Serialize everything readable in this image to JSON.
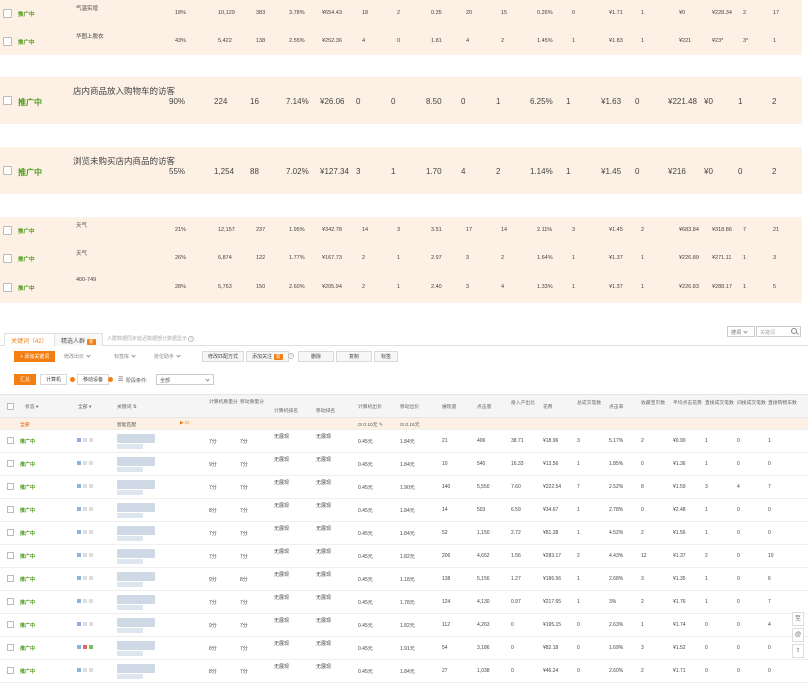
{
  "top_rows": [
    {
      "status": "推广中",
      "name": "气温实增",
      "pct": "18%",
      "views": "10,129",
      "clicks": "383",
      "ctr": "3.78%",
      "cost": "¥654.43",
      "c1": "18",
      "c2": "2",
      "c3": "0.35",
      "c4": "20",
      "c5": "15",
      "rate": "0.26%",
      "c6": "0",
      "cpc": "¥1.71",
      "c7": "1",
      "c8": "¥0",
      "c9": "¥228.34",
      "c10": "2",
      "c11": "17"
    },
    {
      "status": "推广中",
      "name": "华图上脱衣",
      "pct": "43%",
      "views": "5,422",
      "clicks": "138",
      "ctr": "2.55%",
      "cost": "¥252.36",
      "c1": "4",
      "c2": "0",
      "c3": "1.81",
      "c4": "4",
      "c5": "2",
      "rate": "1.45%",
      "c6": "1",
      "cpc": "¥1.83",
      "c7": "1",
      "c8": "¥221",
      "c9": "¥23*",
      "c10": "3*",
      "c11": "1"
    },
    {
      "status": "推广中",
      "name": "店内商品放入购物车的访客",
      "pct": "90%",
      "views": "224",
      "clicks": "16",
      "ctr": "7.14%",
      "cost": "¥26.06",
      "c1": "0",
      "c2": "0",
      "c3": "8.50",
      "c4": "0",
      "c5": "1",
      "rate": "6.25%",
      "c6": "1",
      "cpc": "¥1.63",
      "c7": "0",
      "c8": "¥221.48",
      "c9": "¥0",
      "c10": "1",
      "c11": "2"
    },
    {
      "status": "推广中",
      "name": "浏览未购买店内商品的访客",
      "pct": "55%",
      "views": "1,254",
      "clicks": "88",
      "ctr": "7.02%",
      "cost": "¥127.34",
      "c1": "3",
      "c2": "1",
      "c3": "1.70",
      "c4": "4",
      "c5": "2",
      "rate": "1.14%",
      "c6": "1",
      "cpc": "¥1.45",
      "c7": "0",
      "c8": "¥216",
      "c9": "¥0",
      "c10": "0",
      "c11": "2"
    },
    {
      "status": "推广中",
      "name": "天气",
      "pct": "21%",
      "views": "12,157",
      "clicks": "237",
      "ctr": "1.95%",
      "cost": "¥342.78",
      "c1": "14",
      "c2": "3",
      "c3": "3.51",
      "c4": "17",
      "c5": "14",
      "rate": "2.11%",
      "c6": "3",
      "cpc": "¥1.45",
      "c7": "2",
      "c8": "¥683.84",
      "c9": "¥318.86",
      "c10": "7",
      "c11": "21"
    },
    {
      "status": "推广中",
      "name": "天气",
      "pct": "26%",
      "views": "6,874",
      "clicks": "122",
      "ctr": "1.77%",
      "cost": "¥167.73",
      "c1": "2",
      "c2": "1",
      "c3": "2.97",
      "c4": "3",
      "c5": "2",
      "rate": "1.64%",
      "c6": "1",
      "cpc": "¥1.37",
      "c7": "1",
      "c8": "¥226.89",
      "c9": "¥271.11",
      "c10": "1",
      "c11": "3"
    },
    {
      "status": "推广中",
      "name": "400-749",
      "pct": "28%",
      "views": "5,763",
      "clicks": "150",
      "ctr": "2.60%",
      "cost": "¥205.94",
      "c1": "2",
      "c2": "1",
      "c3": "2.40",
      "c4": "3",
      "c5": "4",
      "rate": "1.33%",
      "c6": "1",
      "cpc": "¥1.37",
      "c7": "1",
      "c8": "¥226.83",
      "c9": "¥288.17",
      "c10": "1",
      "c11": "5"
    }
  ],
  "tabs": {
    "keywords": "关键词（42）",
    "crowd": "精选人群",
    "crowd_badge": "新",
    "hint": "人群数据同步延迟数据部分数据显示"
  },
  "search": {
    "select": "搜词",
    "placeholder": "关键词"
  },
  "toolbar": {
    "add": "+ 添加关键词",
    "modify_bid": "修改出价",
    "label": "标签库",
    "position": "抢位助手",
    "match": "修改匹配方式",
    "attention": "添加关注",
    "attention_badge": "新",
    "delete": "删除",
    "copy": "复制",
    "tag": "标签"
  },
  "filter": {
    "summary": "汇总",
    "computer": "计算机",
    "mobile": "移动设备",
    "period_label": "阶段条件:",
    "period_value": "全部"
  },
  "table": {
    "headers": {
      "status": "状态",
      "all": "全部",
      "keyword": "关键词",
      "pc_quality": "计算机质量分",
      "mobile_quality": "移动质量分",
      "pc_rank": "计算机排名",
      "mobile_rank": "移动排名",
      "pc_bid": "计算机出价",
      "mobile_bid": "移动出价",
      "impressions": "展现量",
      "clicks": "点击量",
      "roi": "投入产出比",
      "cost": "花费",
      "orders": "总成交笔数",
      "ctr": "点击率",
      "fav_items": "收藏宝贝数",
      "avg_cpc": "平均点击花费",
      "direct_orders": "直接成交笔数",
      "indirect_orders": "间接成交笔数",
      "direct_fav": "直接购物车数"
    },
    "subheader": {
      "status": "全部",
      "keyword": "智能匹配",
      "pc_bid": "0.10元",
      "mobile_bid": "0.16元"
    },
    "rows": [
      {
        "status": "推广中",
        "pcq": "7分",
        "mq": "7分",
        "pcr": "无展现",
        "mr": "无展现",
        "pcb": "0.45元",
        "mb": "1.84元",
        "imp": "21",
        "clk": "406",
        "roi": "38.71",
        "cost": "¥18.96",
        "ord": "3",
        "ctr": "5.17%",
        "fav": "2",
        "cpc": "¥0.90",
        "d": "1",
        "i": "0",
        "f": "1"
      },
      {
        "status": "推广中",
        "pcq": "9分",
        "mq": "7分",
        "pcr": "无展现",
        "mr": "无展现",
        "pcb": "0.45元",
        "mb": "1.84元",
        "imp": "10",
        "clk": "540",
        "roi": "16.33",
        "cost": "¥13.56",
        "ord": "1",
        "ctr": "1.85%",
        "fav": "0",
        "cpc": "¥1.36",
        "d": "1",
        "i": "0",
        "f": "0"
      },
      {
        "status": "推广中",
        "pcq": "7分",
        "mq": "7分",
        "pcr": "无展现",
        "mr": "无展现",
        "pcb": "0.45元",
        "mb": "1.90元",
        "imp": "140",
        "clk": "5,550",
        "roi": "7.60",
        "cost": "¥222.54",
        "ord": "7",
        "ctr": "2.52%",
        "fav": "8",
        "cpc": "¥1.59",
        "d": "3",
        "i": "4",
        "f": "7"
      },
      {
        "status": "推广中",
        "pcq": "8分",
        "mq": "7分",
        "pcr": "无展现",
        "mr": "无展现",
        "pcb": "0.45元",
        "mb": "1.84元",
        "imp": "14",
        "clk": "503",
        "roi": "6.59",
        "cost": "¥34.67",
        "ord": "1",
        "ctr": "2.78%",
        "fav": "0",
        "cpc": "¥2.48",
        "d": "1",
        "i": "0",
        "f": "0"
      },
      {
        "status": "推广中",
        "pcq": "7分",
        "mq": "7分",
        "pcr": "无展现",
        "mr": "无展现",
        "pcb": "0.45元",
        "mb": "1.84元",
        "imp": "52",
        "clk": "1,150",
        "roi": "2.72",
        "cost": "¥81.38",
        "ord": "1",
        "ctr": "4.52%",
        "fav": "2",
        "cpc": "¥1.56",
        "d": "1",
        "i": "0",
        "f": "0"
      },
      {
        "status": "推广中",
        "pcq": "7分",
        "mq": "7分",
        "pcr": "无展现",
        "mr": "无展现",
        "pcb": "0.45元",
        "mb": "1.82元",
        "imp": "206",
        "clk": "4,652",
        "roi": "1.56",
        "cost": "¥283.17",
        "ord": "2",
        "ctr": "4.43%",
        "fav": "12",
        "cpc": "¥1.37",
        "d": "2",
        "i": "0",
        "f": "10"
      },
      {
        "status": "推广中",
        "pcq": "9分",
        "mq": "8分",
        "pcr": "无展现",
        "mr": "无展现",
        "pcb": "0.45元",
        "mb": "1.18元",
        "imp": "138",
        "clk": "5,156",
        "roi": "1.27",
        "cost": "¥186.56",
        "ord": "1",
        "ctr": "2.68%",
        "fav": "3",
        "cpc": "¥1.35",
        "d": "1",
        "i": "0",
        "f": "6"
      },
      {
        "status": "推广中",
        "pcq": "7分",
        "mq": "7分",
        "pcr": "无展现",
        "mr": "无展现",
        "pcb": "0.45元",
        "mb": "1.78元",
        "imp": "124",
        "clk": "4,130",
        "roi": "0.97",
        "cost": "¥217.65",
        "ord": "1",
        "ctr": "3%",
        "fav": "2",
        "cpc": "¥1.76",
        "d": "1",
        "i": "0",
        "f": "7"
      },
      {
        "status": "推广中",
        "pcq": "9分",
        "mq": "7分",
        "pcr": "无展现",
        "mr": "无展现",
        "pcb": "0.45元",
        "mb": "1.82元",
        "imp": "112",
        "clk": "4,263",
        "roi": "0",
        "cost": "¥195.15",
        "ord": "0",
        "ctr": "2.63%",
        "fav": "1",
        "cpc": "¥1.74",
        "d": "0",
        "i": "0",
        "f": "4"
      },
      {
        "status": "推广中",
        "pcq": "8分",
        "mq": "7分",
        "pcr": "无展现",
        "mr": "无展现",
        "pcb": "0.45元",
        "mb": "1.91元",
        "imp": "54",
        "clk": "3,186",
        "roi": "0",
        "cost": "¥82.18",
        "ord": "0",
        "ctr": "1.69%",
        "fav": "3",
        "cpc": "¥1.52",
        "d": "0",
        "i": "0",
        "f": "0"
      },
      {
        "status": "推广中",
        "pcq": "8分",
        "mq": "7分",
        "pcr": "无展现",
        "mr": "无展现",
        "pcb": "0.45元",
        "mb": "1.84元",
        "imp": "27",
        "clk": "1,038",
        "roi": "0",
        "cost": "¥46.24",
        "ord": "0",
        "ctr": "2.60%",
        "fav": "2",
        "cpc": "¥1.71",
        "d": "0",
        "i": "0",
        "f": "0"
      }
    ]
  },
  "colors": {
    "accent": "#f37f12",
    "status_green": "#4f9a1c",
    "row_highlight": "#fdf0e4"
  }
}
